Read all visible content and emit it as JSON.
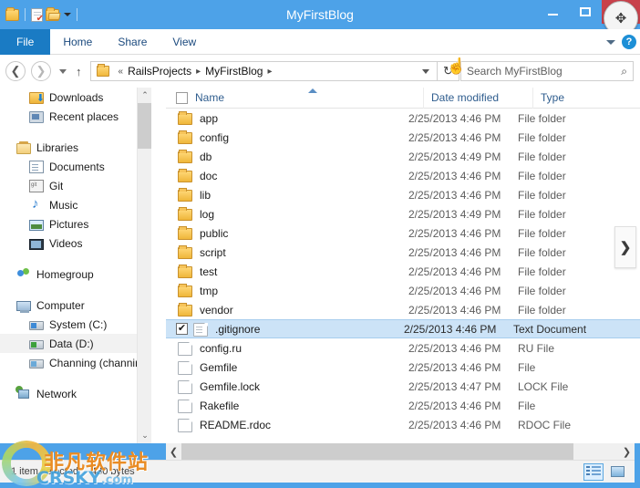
{
  "window": {
    "title": "MyFirstBlog",
    "controls": {
      "minimize": "—",
      "maximize": "❐",
      "close": "✕"
    },
    "quick_access": {
      "folder_icon": "folder-icon",
      "new_folder_icon": "new-folder-icon",
      "properties_icon": "properties-icon",
      "dropdown": "▾"
    },
    "move_cursor_glyph": "✥"
  },
  "ribbon": {
    "tabs": [
      {
        "label": "File",
        "active": true
      },
      {
        "label": "Home",
        "active": false
      },
      {
        "label": "Share",
        "active": false
      },
      {
        "label": "View",
        "active": false
      }
    ],
    "expand_icon": "chevron-down-icon",
    "help_label": "?"
  },
  "address": {
    "back_glyph": "❮",
    "forward_glyph": "❯",
    "recent_glyph": "▾",
    "up_glyph": "↑",
    "prefix": "«",
    "crumbs": [
      "RailsProjects",
      "MyFirstBlog"
    ],
    "separator": "▸",
    "dropdown_glyph": "▾",
    "refresh_glyph": "↻",
    "hand_cursor_glyph": "☝"
  },
  "search": {
    "placeholder": "Search MyFirstBlog",
    "value": "",
    "icon": "search-icon",
    "icon_glyph": "⌕"
  },
  "sidebar": {
    "groups": [
      {
        "items": [
          {
            "label": "Downloads",
            "icon": "downloads-folder-icon",
            "indent": true,
            "selected": false
          },
          {
            "label": "Recent places",
            "icon": "recent-places-icon",
            "indent": true,
            "selected": false
          }
        ]
      },
      {
        "items": [
          {
            "label": "Libraries",
            "icon": "libraries-icon",
            "indent": false,
            "selected": false
          },
          {
            "label": "Documents",
            "icon": "documents-icon",
            "indent": true,
            "selected": false
          },
          {
            "label": "Git",
            "icon": "git-library-icon",
            "indent": true,
            "selected": false
          },
          {
            "label": "Music",
            "icon": "music-icon",
            "indent": true,
            "selected": false
          },
          {
            "label": "Pictures",
            "icon": "pictures-icon",
            "indent": true,
            "selected": false
          },
          {
            "label": "Videos",
            "icon": "videos-icon",
            "indent": true,
            "selected": false
          }
        ]
      },
      {
        "items": [
          {
            "label": "Homegroup",
            "icon": "homegroup-icon",
            "indent": false,
            "selected": false
          }
        ]
      },
      {
        "items": [
          {
            "label": "Computer",
            "icon": "computer-icon",
            "indent": false,
            "selected": false
          },
          {
            "label": "System (C:)",
            "icon": "drive-c-icon",
            "indent": true,
            "selected": false
          },
          {
            "label": "Data (D:)",
            "icon": "drive-d-icon",
            "indent": true,
            "selected": true
          },
          {
            "label": "Channing (channing",
            "icon": "network-drive-icon",
            "indent": true,
            "selected": false
          }
        ]
      },
      {
        "items": [
          {
            "label": "Network",
            "icon": "network-icon",
            "indent": false,
            "selected": false
          }
        ]
      }
    ],
    "scroll": {
      "up_glyph": "⌃",
      "down_glyph": "⌄"
    }
  },
  "filelist": {
    "columns": [
      {
        "key": "name",
        "label": "Name",
        "sorted": true
      },
      {
        "key": "date",
        "label": "Date modified",
        "sorted": false
      },
      {
        "key": "type",
        "label": "Type",
        "sorted": false
      }
    ],
    "select_all_checked": false,
    "sort_arrow": "ascending",
    "check_glyph": "✔",
    "rows": [
      {
        "name": "app",
        "date": "2/25/2013 4:46 PM",
        "type": "File folder",
        "icon": "folder",
        "selected": false
      },
      {
        "name": "config",
        "date": "2/25/2013 4:46 PM",
        "type": "File folder",
        "icon": "folder",
        "selected": false
      },
      {
        "name": "db",
        "date": "2/25/2013 4:49 PM",
        "type": "File folder",
        "icon": "folder",
        "selected": false
      },
      {
        "name": "doc",
        "date": "2/25/2013 4:46 PM",
        "type": "File folder",
        "icon": "folder",
        "selected": false
      },
      {
        "name": "lib",
        "date": "2/25/2013 4:46 PM",
        "type": "File folder",
        "icon": "folder",
        "selected": false
      },
      {
        "name": "log",
        "date": "2/25/2013 4:49 PM",
        "type": "File folder",
        "icon": "folder",
        "selected": false
      },
      {
        "name": "public",
        "date": "2/25/2013 4:46 PM",
        "type": "File folder",
        "icon": "folder",
        "selected": false
      },
      {
        "name": "script",
        "date": "2/25/2013 4:46 PM",
        "type": "File folder",
        "icon": "folder",
        "selected": false
      },
      {
        "name": "test",
        "date": "2/25/2013 4:46 PM",
        "type": "File folder",
        "icon": "folder",
        "selected": false
      },
      {
        "name": "tmp",
        "date": "2/25/2013 4:46 PM",
        "type": "File folder",
        "icon": "folder",
        "selected": false
      },
      {
        "name": "vendor",
        "date": "2/25/2013 4:46 PM",
        "type": "File folder",
        "icon": "folder",
        "selected": false
      },
      {
        "name": ".gitignore",
        "date": "2/25/2013 4:46 PM",
        "type": "Text Document",
        "icon": "file-txt",
        "selected": true
      },
      {
        "name": "config.ru",
        "date": "2/25/2013 4:46 PM",
        "type": "RU File",
        "icon": "file",
        "selected": false
      },
      {
        "name": "Gemfile",
        "date": "2/25/2013 4:46 PM",
        "type": "File",
        "icon": "file",
        "selected": false
      },
      {
        "name": "Gemfile.lock",
        "date": "2/25/2013 4:47 PM",
        "type": "LOCK File",
        "icon": "file",
        "selected": false
      },
      {
        "name": "Rakefile",
        "date": "2/25/2013 4:46 PM",
        "type": "File",
        "icon": "file",
        "selected": false
      },
      {
        "name": "README.rdoc",
        "date": "2/25/2013 4:46 PM",
        "type": "RDOC File",
        "icon": "file",
        "selected": false
      }
    ],
    "next_pane_glyph": "❯"
  },
  "hscroll": {
    "left_glyph": "❮",
    "right_glyph": "❯"
  },
  "statusbar": {
    "items_text": "",
    "selection_text": "1 item selected",
    "size_text": "430 bytes",
    "views": [
      {
        "name": "details-view",
        "active": true
      },
      {
        "name": "large-icons-view",
        "active": false
      }
    ]
  },
  "watermark": {
    "chinese": "非凡软件站",
    "english": "CRSKY",
    "english_suffix": ".com"
  },
  "colors": {
    "accent": "#4da2e8",
    "file_tab": "#1a7bc4",
    "close_button": "#c8414b",
    "selection": "#cce3f7",
    "header_text": "#2f5d8e"
  }
}
